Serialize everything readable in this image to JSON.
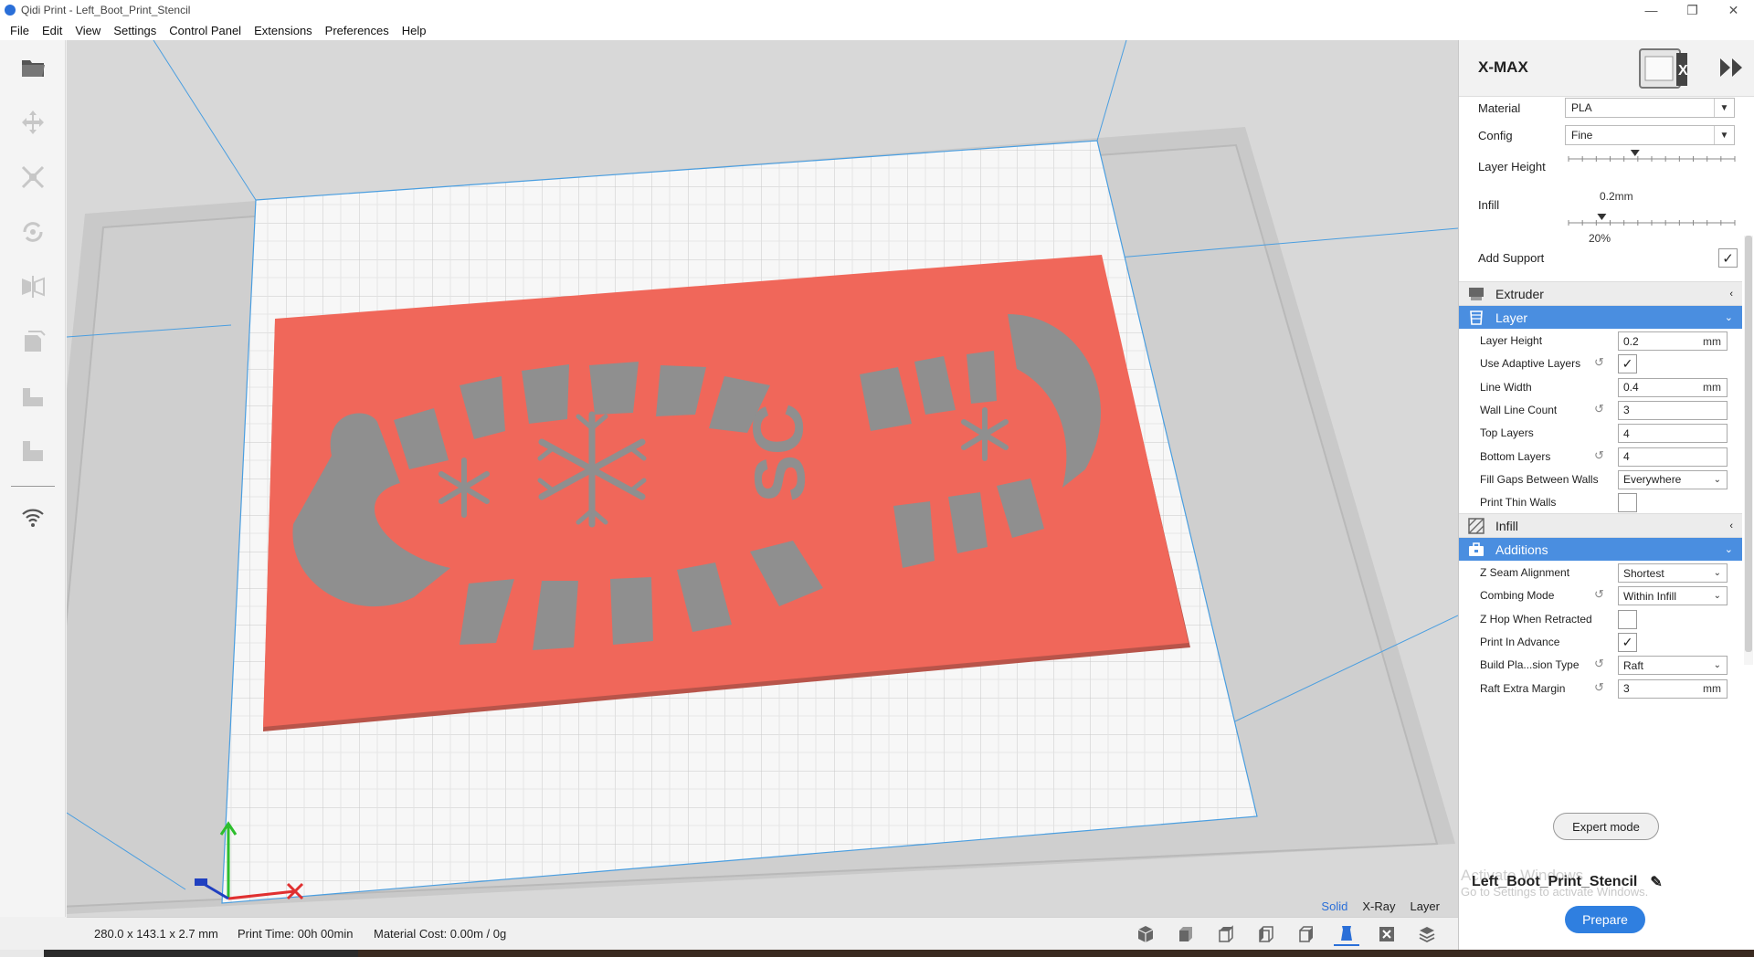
{
  "window": {
    "title": "Qidi Print - Left_Boot_Print_Stencil",
    "buttons": [
      "—",
      "❐",
      "✕"
    ]
  },
  "menu": [
    "File",
    "Edit",
    "View",
    "Settings",
    "Control Panel",
    "Extensions",
    "Preferences",
    "Help"
  ],
  "left_tools": [
    "open-folder-icon",
    "move-icon",
    "scale-icon",
    "rotate-icon",
    "mirror-icon",
    "per-model-settings-icon",
    "support-blocker-icon",
    "layer-view-icon",
    "wifi-icon"
  ],
  "viewport": {
    "view_modes": [
      "Solid",
      "X-Ray",
      "Layer"
    ],
    "active_mode": "Solid",
    "model_color": "#f0675a",
    "plate_color": "#f7f7f7"
  },
  "status": {
    "dimensions": "280.0 x 143.1 x 2.7 mm",
    "print_time": "Print Time: 00h 00min",
    "material_cost": "Material Cost: 0.00m / 0g",
    "view_icons": [
      "3d-view-icon",
      "front-view-icon",
      "top-view-icon",
      "left-view-icon",
      "right-view-icon",
      "solid-view-icon",
      "xray-view-icon",
      "layer-view-icon"
    ]
  },
  "panel": {
    "printer_name": "X-MAX",
    "material_label": "Material",
    "material_value": "PLA",
    "config_label": "Config",
    "config_value": "Fine",
    "layer_height_label": "Layer Height",
    "layer_height_value": "0.2mm",
    "layer_height_fraction": 0.4,
    "infill_label": "Infill",
    "infill_value": "20%",
    "infill_fraction": 0.2,
    "add_support_label": "Add Support",
    "add_support_checked": true,
    "sections": {
      "extruder": "Extruder",
      "layer": "Layer",
      "infill": "Infill",
      "additions": "Additions"
    },
    "layer_settings": [
      {
        "label": "Layer Height",
        "value": "0.2",
        "unit": "mm",
        "type": "field",
        "reset": false
      },
      {
        "label": "Use Adaptive Layers",
        "type": "checkbox",
        "checked": true,
        "reset": true
      },
      {
        "label": "Line Width",
        "value": "0.4",
        "unit": "mm",
        "type": "field",
        "reset": false
      },
      {
        "label": "Wall Line Count",
        "value": "3",
        "unit": "",
        "type": "field",
        "reset": true
      },
      {
        "label": "Top Layers",
        "value": "4",
        "unit": "",
        "type": "field",
        "reset": false
      },
      {
        "label": "Bottom Layers",
        "value": "4",
        "unit": "",
        "type": "field",
        "reset": true
      },
      {
        "label": "Fill Gaps Between Walls",
        "value": "Everywhere",
        "type": "select",
        "reset": false
      },
      {
        "label": "Print Thin Walls",
        "type": "checkbox",
        "checked": false,
        "reset": false
      }
    ],
    "additions_settings": [
      {
        "label": "Z Seam Alignment",
        "value": "Shortest",
        "type": "select",
        "reset": false
      },
      {
        "label": "Combing Mode",
        "value": "Within Infill",
        "type": "select",
        "reset": true
      },
      {
        "label": "Z Hop When Retracted",
        "type": "checkbox",
        "checked": false,
        "reset": false
      },
      {
        "label": "Print In Advance",
        "type": "checkbox",
        "checked": true,
        "reset": false
      },
      {
        "label": "Build Pla...sion Type",
        "value": "Raft",
        "type": "select",
        "reset": true
      },
      {
        "label": "Raft Extra Margin",
        "value": "3",
        "unit": "mm",
        "type": "field",
        "reset": true
      }
    ],
    "expert_button": "Expert mode",
    "job_name": "Left_Boot_Print_Stencil",
    "watermark_title": "Activate Windows",
    "watermark_sub": "Go to Settings to activate Windows.",
    "prepare_button": "Prepare"
  }
}
